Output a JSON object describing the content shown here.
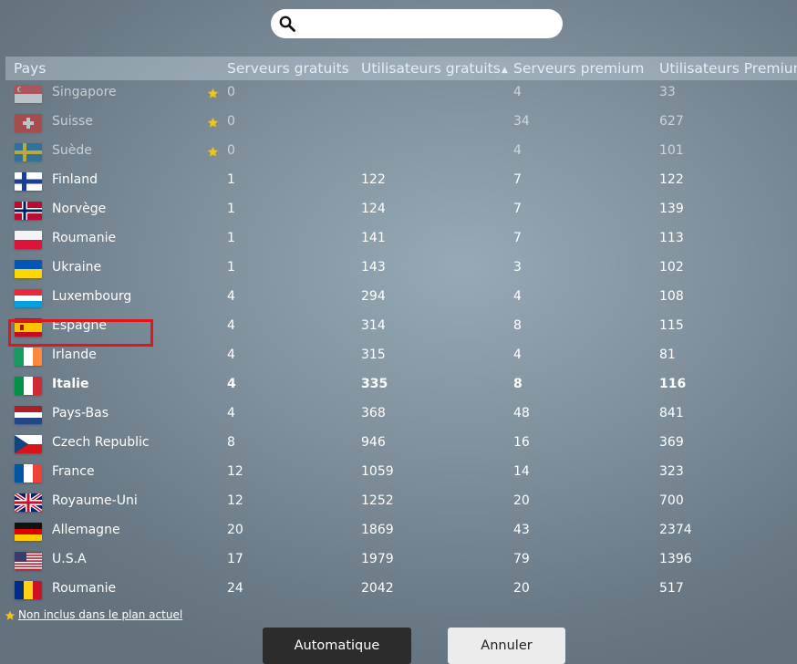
{
  "search": {
    "placeholder": ""
  },
  "columns": {
    "country": "Pays",
    "free_servers": "Serveurs gratuits",
    "free_users": "Utilisateurs gratuits",
    "premium_servers": "Serveurs premium",
    "premium_users": "Utilisateurs Premium"
  },
  "sort": {
    "column": "free_users",
    "direction": "ascending",
    "arrow": "▲"
  },
  "countries": [
    {
      "name": "Singapore",
      "flag": "singapore-flag",
      "free_servers": "0",
      "free_users": "",
      "premium_servers": "4",
      "premium_users": "33",
      "premium_only": true
    },
    {
      "name": "Suisse",
      "flag": "switzerland-flag",
      "free_servers": "0",
      "free_users": "",
      "premium_servers": "34",
      "premium_users": "627",
      "premium_only": true
    },
    {
      "name": "Suède",
      "flag": "sweden-flag",
      "free_servers": "0",
      "free_users": "",
      "premium_servers": "4",
      "premium_users": "101",
      "premium_only": true
    },
    {
      "name": "Finland",
      "flag": "finland-flag",
      "free_servers": "1",
      "free_users": "122",
      "premium_servers": "7",
      "premium_users": "122"
    },
    {
      "name": "Norvège",
      "flag": "norway-flag",
      "free_servers": "1",
      "free_users": "124",
      "premium_servers": "7",
      "premium_users": "139"
    },
    {
      "name": "Roumanie",
      "flag": "poland-flag",
      "free_servers": "1",
      "free_users": "141",
      "premium_servers": "7",
      "premium_users": "113"
    },
    {
      "name": "Ukraine",
      "flag": "ukraine-flag",
      "free_servers": "1",
      "free_users": "143",
      "premium_servers": "3",
      "premium_users": "102"
    },
    {
      "name": "Luxembourg",
      "flag": "luxembourg-flag",
      "free_servers": "4",
      "free_users": "294",
      "premium_servers": "4",
      "premium_users": "108"
    },
    {
      "name": "Espagne",
      "flag": "spain-flag",
      "free_servers": "4",
      "free_users": "314",
      "premium_servers": "8",
      "premium_users": "115"
    },
    {
      "name": "Irlande",
      "flag": "ireland-flag",
      "free_servers": "4",
      "free_users": "315",
      "premium_servers": "4",
      "premium_users": "81"
    },
    {
      "name": "Italie",
      "flag": "italy-flag",
      "free_servers": "4",
      "free_users": "335",
      "premium_servers": "8",
      "premium_users": "116",
      "bold": true
    },
    {
      "name": "Pays-Bas",
      "flag": "netherlands-flag",
      "free_servers": "4",
      "free_users": "368",
      "premium_servers": "48",
      "premium_users": "841",
      "highlighted": true
    },
    {
      "name": "Czech Republic",
      "flag": "czech-flag",
      "free_servers": "8",
      "free_users": "946",
      "premium_servers": "16",
      "premium_users": "369"
    },
    {
      "name": "France",
      "flag": "france-flag",
      "free_servers": "12",
      "free_users": "1059",
      "premium_servers": "14",
      "premium_users": "323"
    },
    {
      "name": "Royaume-Uni",
      "flag": "uk-flag",
      "free_servers": "12",
      "free_users": "1252",
      "premium_servers": "20",
      "premium_users": "700"
    },
    {
      "name": "Allemagne",
      "flag": "germany-flag",
      "free_servers": "20",
      "free_users": "1869",
      "premium_servers": "43",
      "premium_users": "2374"
    },
    {
      "name": "U.S.A",
      "flag": "usa-flag",
      "free_servers": "17",
      "free_users": "1979",
      "premium_servers": "79",
      "premium_users": "1396"
    },
    {
      "name": "Roumanie",
      "flag": "romania-flag",
      "free_servers": "24",
      "free_users": "2042",
      "premium_servers": "20",
      "premium_users": "517"
    }
  ],
  "legend": {
    "text": "Non inclus dans le plan actuel",
    "icon": "star-icon"
  },
  "buttons": {
    "auto": "Automatique",
    "cancel": "Annuler"
  },
  "colors": {
    "star": "#f2c318",
    "highlight": "#e0161c",
    "primary_button": "#2c2c2c"
  }
}
